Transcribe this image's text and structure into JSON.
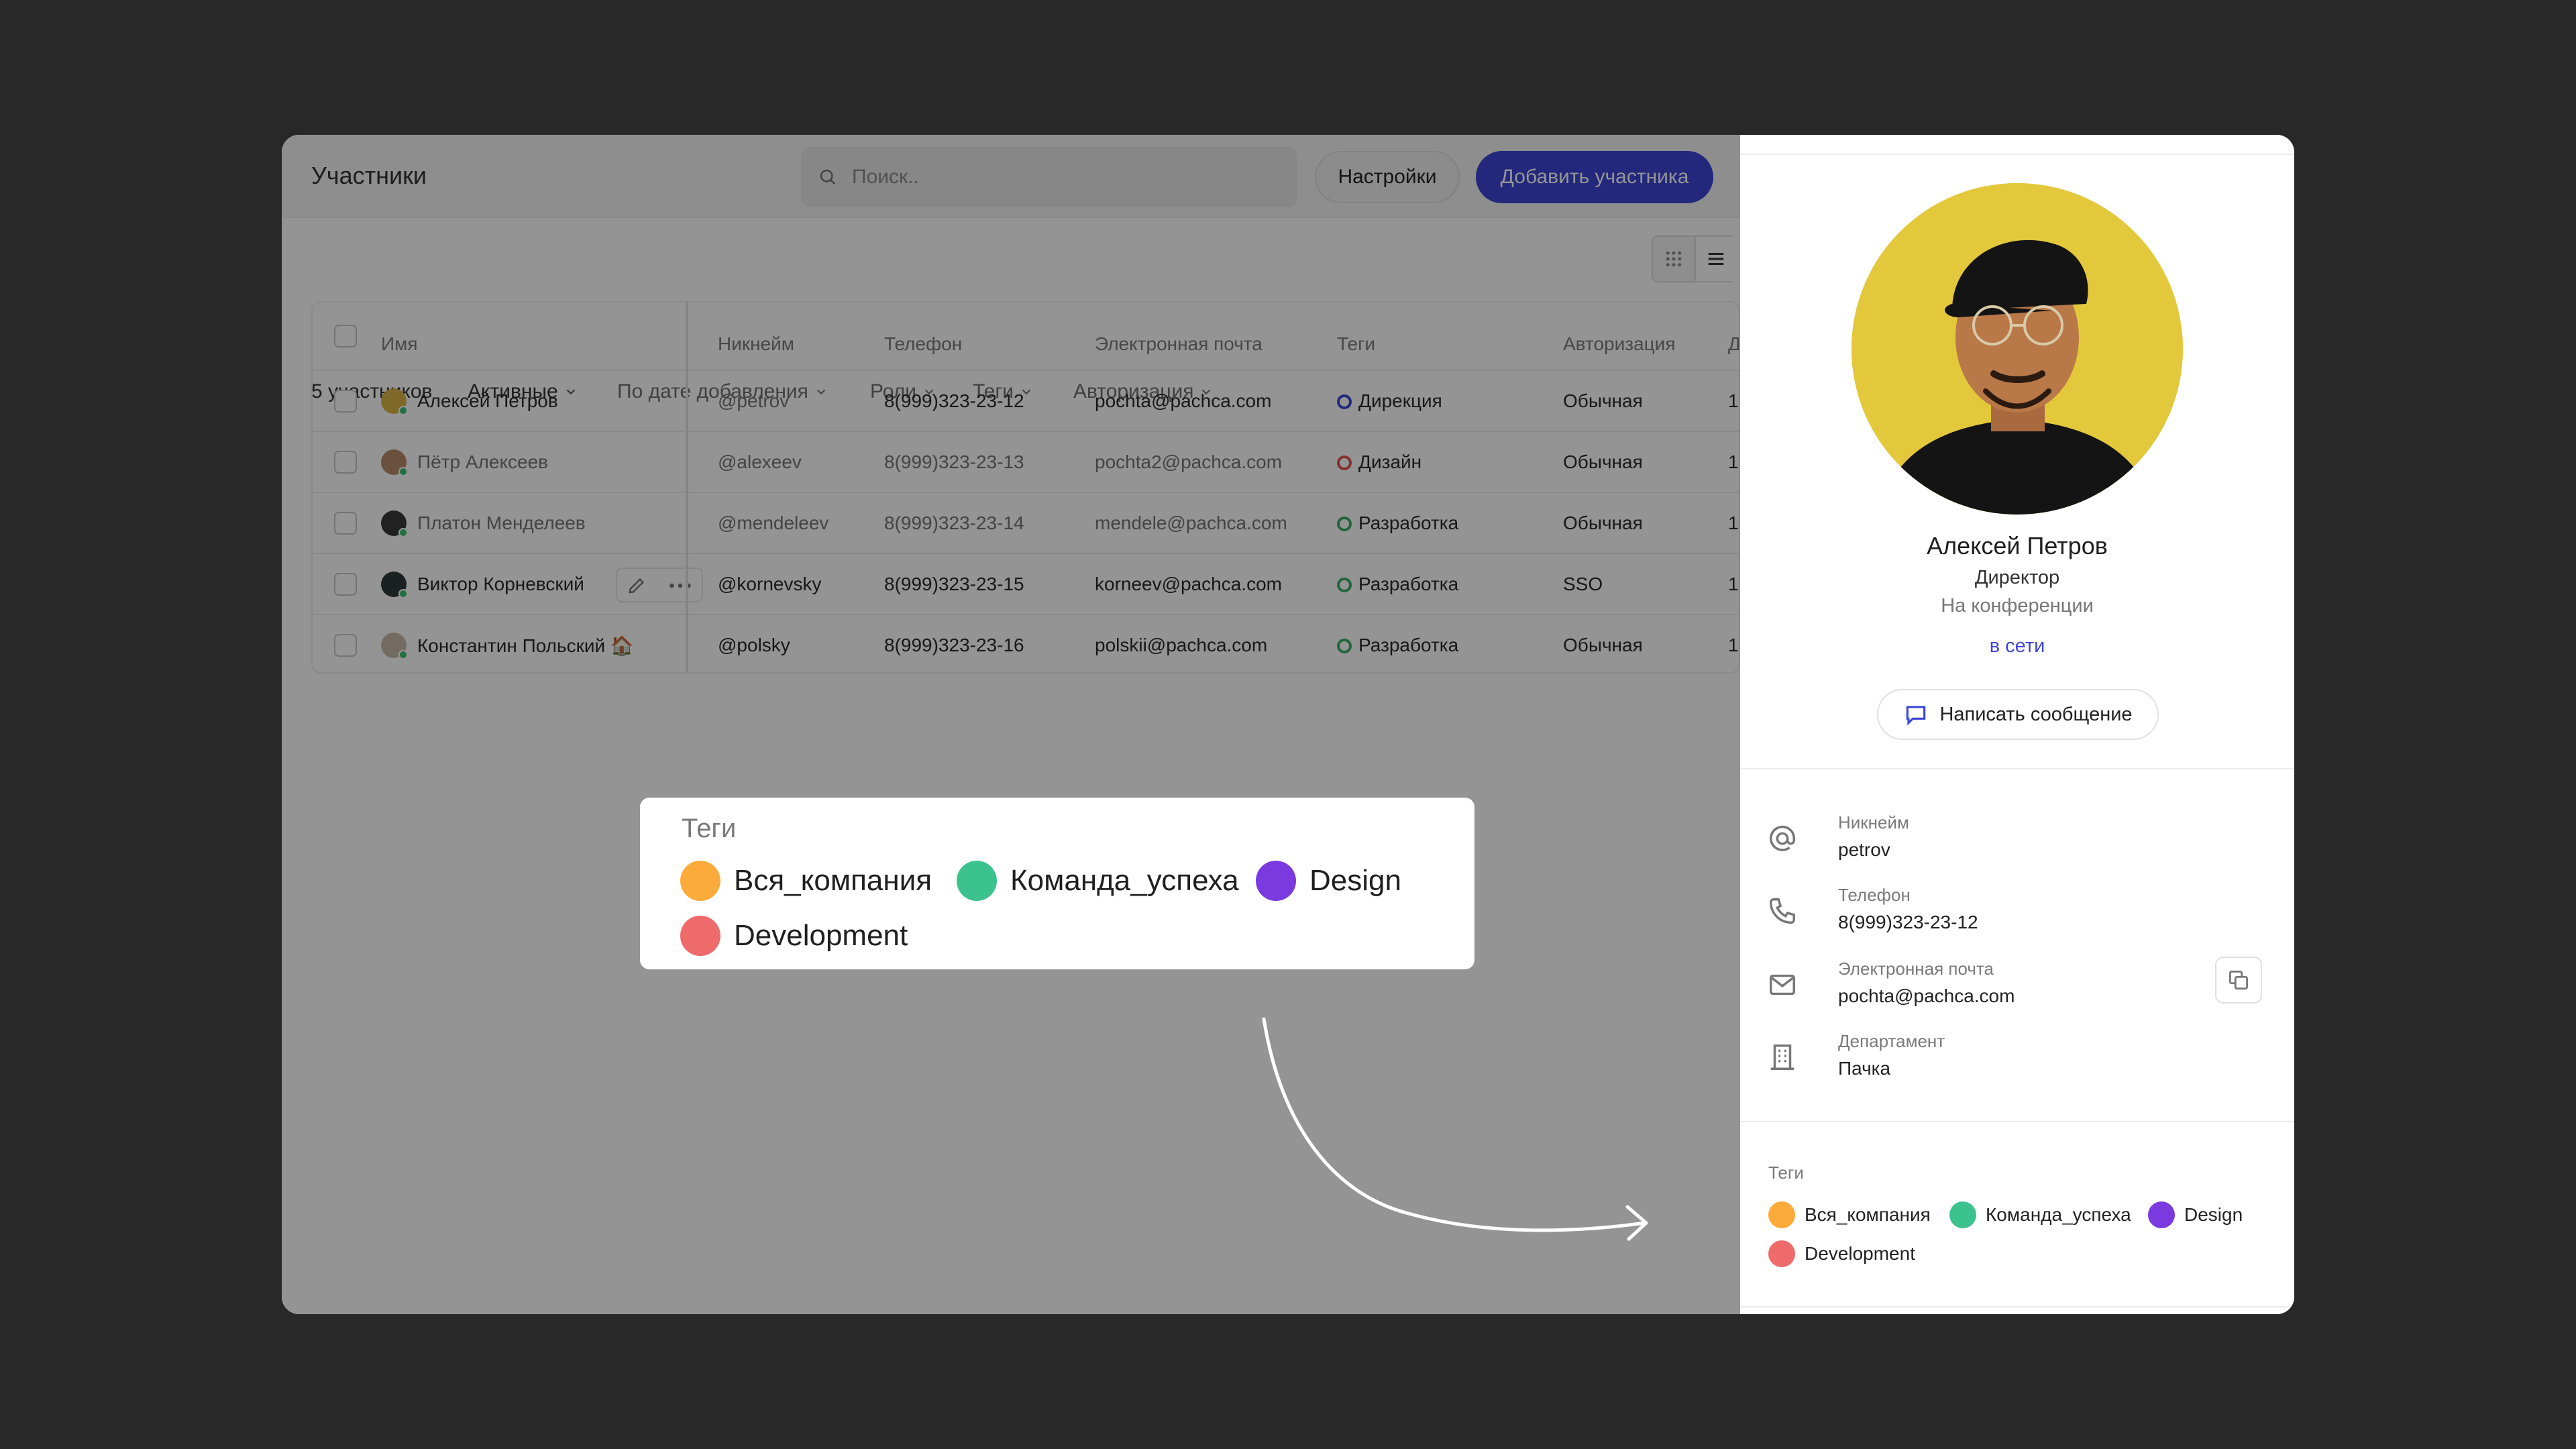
{
  "header": {
    "title": "Участники",
    "search_placeholder": "Поиск..",
    "settings_label": "Настройки",
    "add_member_label": "Добавить участника"
  },
  "filters": {
    "count": "5 участников",
    "status": "Активные",
    "sort": "По дате добавления",
    "roles": "Роли",
    "tags": "Теги",
    "auth": "Авторизация"
  },
  "table": {
    "columns": [
      "Имя",
      "Никнейм",
      "Телефон",
      "Электронная почта",
      "Теги",
      "Авторизация",
      "Д"
    ],
    "rows": [
      {
        "name": "Алексей Петров",
        "nick": "@petrov",
        "phone": "8(999)323-23-12",
        "email": "pochta@pachca.com",
        "tag": "Дирекция",
        "tag_color": "#3d46d6",
        "auth": "Обычная",
        "extra": "1"
      },
      {
        "name": "Пётр Алексеев",
        "nick": "@alexeev",
        "phone": "8(999)323-23-13",
        "email": "pochta2@pachca.com",
        "tag": "Дизайн",
        "tag_color": "#e0564f",
        "auth": "Обычная",
        "extra": "1"
      },
      {
        "name": "Платон Менделеев",
        "nick": "@mendeleev",
        "phone": "8(999)323-23-14",
        "email": "mendele@pachca.com",
        "tag": "Разработка",
        "tag_color": "#3cae6a",
        "auth": "Обычная",
        "extra": "1"
      },
      {
        "name": "Виктор Корневский",
        "nick": "@kornevsky",
        "phone": "8(999)323-23-15",
        "email": "korneev@pachca.com",
        "tag": "Разработка",
        "tag_color": "#3cae6a",
        "auth": "SSO",
        "extra": "1"
      },
      {
        "name": "Константин Польский 🏠",
        "nick": "@polsky",
        "phone": "8(999)323-23-16",
        "email": "polskii@pachca.com",
        "tag": "Разработка",
        "tag_color": "#3cae6a",
        "auth": "Обычная",
        "extra": "1"
      }
    ]
  },
  "tags_popup": {
    "title": "Теги",
    "tags": [
      {
        "label": "Вся_компания",
        "color": "#fbab3a"
      },
      {
        "label": "Команда_успеха",
        "color": "#3cc28f"
      },
      {
        "label": "Design",
        "color": "#7a3ae0"
      },
      {
        "label": "Development",
        "color": "#ef6a6a"
      }
    ]
  },
  "profile": {
    "name": "Алексей Петров",
    "role": "Директор",
    "status": "На конференции",
    "online": "в сети",
    "message_button": "Написать сообщение",
    "fields": [
      {
        "icon": "at-icon",
        "label": "Никнейм",
        "value": "petrov"
      },
      {
        "icon": "phone-icon",
        "label": "Телефон",
        "value": "8(999)323-23-12"
      },
      {
        "icon": "mail-icon",
        "label": "Электронная почта",
        "value": "pochta@pachca.com"
      },
      {
        "icon": "building-icon",
        "label": "Департамент",
        "value": "Пачка"
      }
    ],
    "tags_title": "Теги",
    "tags": [
      {
        "label": "Вся_компания",
        "color": "#fbab3a"
      },
      {
        "label": "Команда_успеха",
        "color": "#3cc28f"
      },
      {
        "label": "Design",
        "color": "#7a3ae0"
      },
      {
        "label": "Development",
        "color": "#ef6a6a"
      }
    ]
  },
  "colors": {
    "accent": "#3d46d6",
    "online": "#38c172",
    "photo_background": "#e3c83c"
  }
}
